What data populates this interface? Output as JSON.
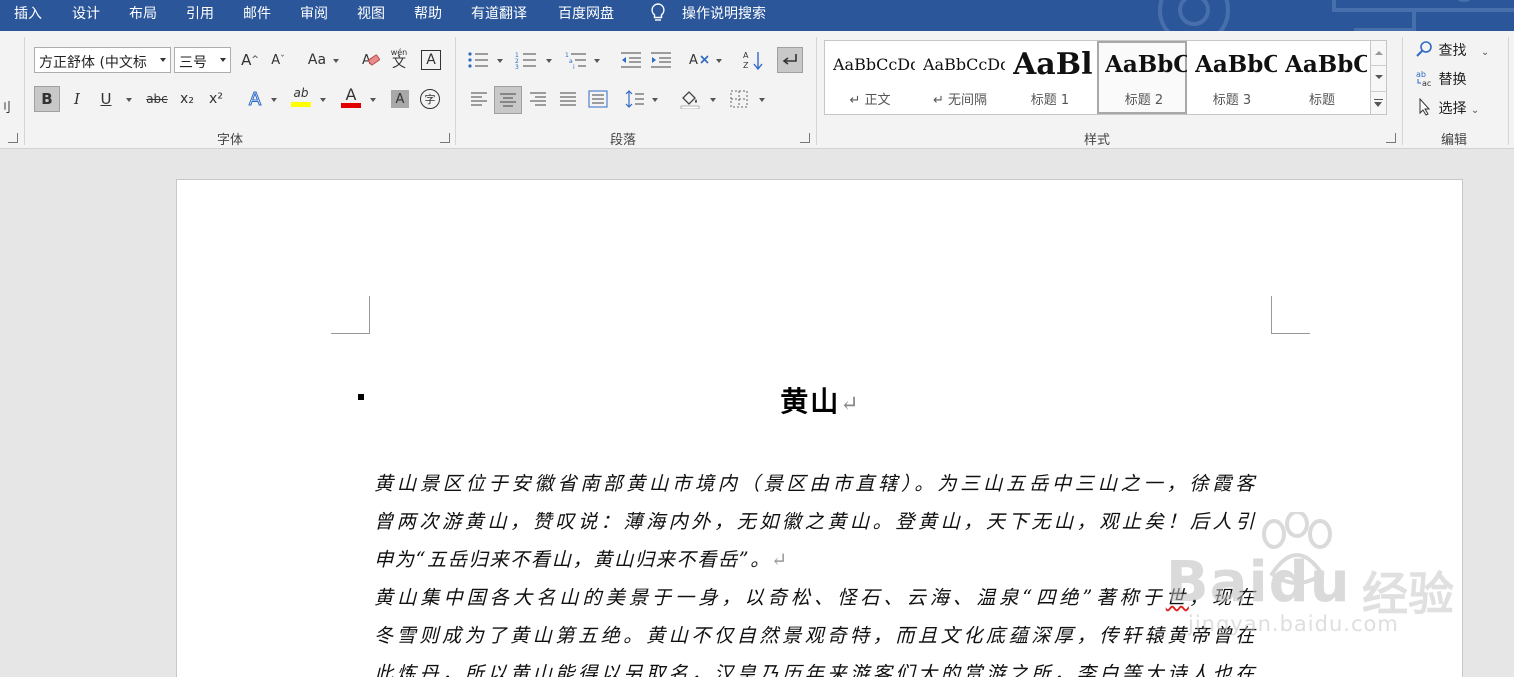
{
  "menu": {
    "items": [
      "插入",
      "设计",
      "布局",
      "引用",
      "邮件",
      "审阅",
      "视图",
      "帮助",
      "有道翻译",
      "百度网盘"
    ],
    "search_label": "操作说明搜索"
  },
  "ribbon": {
    "font": {
      "font_name": "方正舒体 (中文标",
      "font_size": "三号",
      "group_label": "字体",
      "change_case": "Aa",
      "phonetic_top": "wén",
      "phonetic_char": "文",
      "border_char": "A",
      "bold": "B",
      "italic": "I",
      "underline": "U",
      "strike": "abc",
      "subscript": "x₂",
      "superscript": "x²",
      "text_effects": "A",
      "highlight": "ab",
      "font_color": "A",
      "char_shading": "A",
      "enclosed_char": "字"
    },
    "paragraph": {
      "group_label": "段落"
    },
    "styles": {
      "group_label": "样式",
      "items": [
        {
          "sample": "AaBbCcDd",
          "name": "↵ 正文"
        },
        {
          "sample": "AaBbCcDd",
          "name": "↵ 无间隔"
        },
        {
          "sample": "AaBl",
          "name": "标题 1"
        },
        {
          "sample": "AaBbC",
          "name": "标题 2",
          "selected": true
        },
        {
          "sample": "AaBbC",
          "name": "标题 3"
        },
        {
          "sample": "AaBbC",
          "name": "标题"
        }
      ]
    },
    "editing": {
      "group_label": "编辑",
      "find": "查找",
      "replace": "替换",
      "select": "选择"
    },
    "left_edge_char": "刂"
  },
  "document": {
    "title": "黄山",
    "paragraph_mark": "↵",
    "paragraph1": {
      "line1": "黄山景区位于安徽省南部黄山市境内（景区由市直辖）。为三山五岳中三山之一，徐霞客",
      "line2": "曾两次游黄山，赞叹说：薄海内外，无如徽之黄山。登黄山，天下无山，观止矣！后人引",
      "line3": "申为“五岳归来不看山，黄山归来不看岳”。"
    },
    "paragraph2": {
      "line1_a": "黄山集中国各大名山的美景于一身，以奇松、怪石、云海、温泉“四绝”著称于",
      "line1_err": "世",
      "line1_b": "，现在",
      "line2": "冬雪则成为了黄山第五绝。黄山不仅自然景观奇特，而且文化底蕴深厚，传轩辕黄帝曾在",
      "line3": "此炼丹，所以黄山能得以另取名，汉皇乃历年来游客们大的赏游之所，李白等大诗人也在"
    }
  },
  "watermark": {
    "brand": "Baidu",
    "cn": "经验",
    "url": "jingyan.baidu.com"
  },
  "colors": {
    "menu_bg": "#2b579a",
    "ribbon_bg": "#f3f3f3",
    "canvas_bg": "#e6e6e6",
    "highlight_yellow": "#ffff00",
    "font_color_red": "#e00000"
  }
}
